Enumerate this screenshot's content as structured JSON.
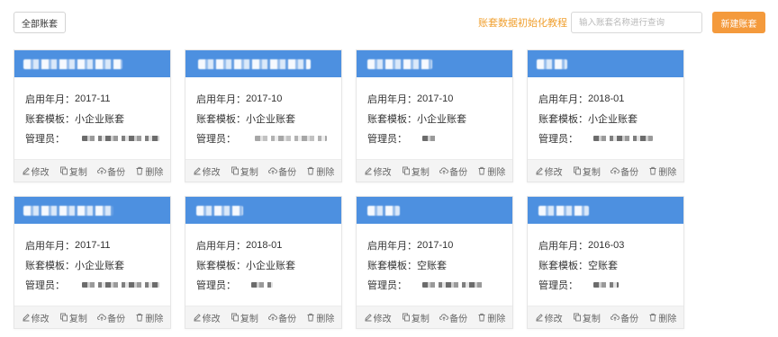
{
  "toolbar": {
    "all_label": "全部账套",
    "tutorial_label": "账套数据初始化教程",
    "search_placeholder": "输入账套名称进行查询",
    "search_value": "",
    "new_label": "新建账套"
  },
  "labels": {
    "start": "启用年月：",
    "template": "账套模板：",
    "admin": "管理员："
  },
  "actions": {
    "edit": "修改",
    "copy": "复制",
    "backup": "备份",
    "delete": "删除"
  },
  "cards": [
    {
      "start": "2017-11",
      "template": "小企业账套"
    },
    {
      "start": "2017-10",
      "template": "小企业账套"
    },
    {
      "start": "2017-10",
      "template": "小企业账套"
    },
    {
      "start": "2018-01",
      "template": "小企业账套"
    },
    {
      "start": "2017-11",
      "template": "小企业账套"
    },
    {
      "start": "2018-01",
      "template": "小企业账套"
    },
    {
      "start": "2017-10",
      "template": "空账套"
    },
    {
      "start": "2016-03",
      "template": "空账套"
    }
  ],
  "icons": {
    "edit": "pencil-icon",
    "copy": "copy-icon",
    "backup": "cloud-upload-icon",
    "delete": "trash-icon"
  },
  "colors": {
    "header_blue": "#4d90e0",
    "accent_orange": "#f49a3c",
    "link_orange": "#f0a030"
  }
}
